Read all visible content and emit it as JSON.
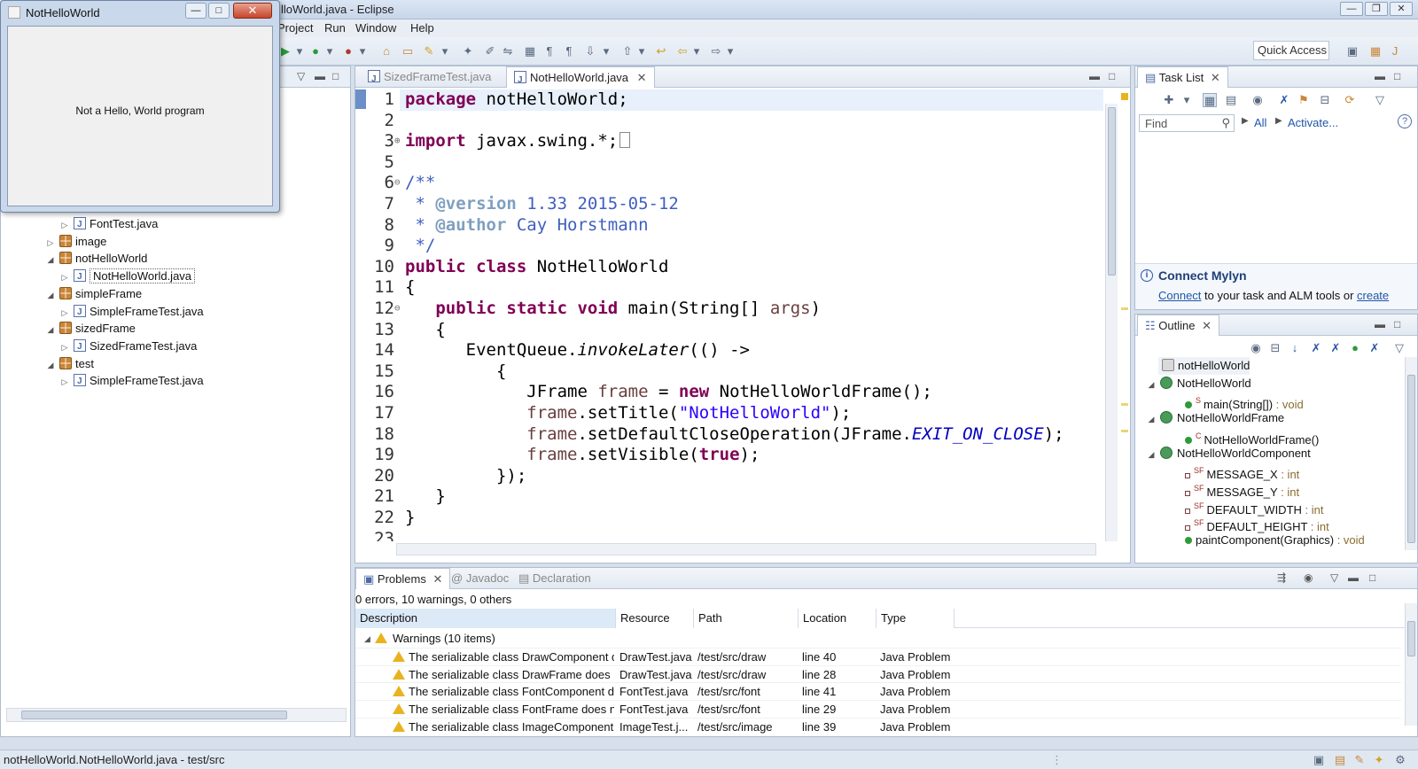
{
  "window": {
    "title": "NotHelloWorld.java - Eclipse",
    "title_visible": "lloWorld.java - Eclipse"
  },
  "menu": {
    "items": [
      "Project",
      "Run",
      "Window",
      "Help"
    ]
  },
  "toolbar": {
    "quick_access": "Quick Access"
  },
  "swing_window": {
    "title": "NotHelloWorld",
    "message": "Not a Hello, World program",
    "close": "✕",
    "min": "—",
    "max": "□"
  },
  "explorer": {
    "items": [
      {
        "label": "FontTest.java",
        "type": "file",
        "depth": 2
      },
      {
        "label": "image",
        "type": "package",
        "depth": 1,
        "expanded": false
      },
      {
        "label": "notHelloWorld",
        "type": "package",
        "depth": 1,
        "expanded": true
      },
      {
        "label": "NotHelloWorld.java",
        "type": "file",
        "depth": 2,
        "selected": true
      },
      {
        "label": "simpleFrame",
        "type": "package",
        "depth": 1,
        "expanded": true
      },
      {
        "label": "SimpleFrameTest.java",
        "type": "file",
        "depth": 2
      },
      {
        "label": "sizedFrame",
        "type": "package",
        "depth": 1,
        "expanded": true
      },
      {
        "label": "SizedFrameTest.java",
        "type": "file",
        "depth": 2
      },
      {
        "label": "test",
        "type": "package",
        "depth": 1,
        "expanded": true
      },
      {
        "label": "SimpleFrameTest.java",
        "type": "file",
        "depth": 2
      }
    ]
  },
  "editor": {
    "tabs": [
      {
        "label": "SizedFrameTest.java",
        "active": false
      },
      {
        "label": "NotHelloWorld.java",
        "active": true
      }
    ],
    "line_numbers": [
      "1",
      "2",
      "3",
      "5",
      "6",
      "7",
      "8",
      "9",
      "10",
      "11",
      "12",
      "13",
      "14",
      "15",
      "16",
      "17",
      "18",
      "19",
      "20",
      "21",
      "22",
      "23"
    ],
    "code": {
      "l1_kw": "package",
      "l1_rest": " notHelloWorld;",
      "l3_kw": "import",
      "l3_rest": " javax.swing.*;",
      "l6": "/**",
      "l7_pre": " * ",
      "l7_tag": "@version",
      "l7_rest": " 1.33 2015-05-12",
      "l8_pre": " * ",
      "l8_tag": "@author",
      "l8_rest": " Cay Horstmann",
      "l9": " */",
      "l10_kw": "public class",
      "l10_rest": " NotHelloWorld",
      "l11": "{",
      "l12_kw": "   public static void",
      "l12_mid": " main(String[] ",
      "l12_var": "args",
      "l12_end": ")",
      "l13": "   {",
      "l14_pre": "      EventQueue.",
      "l14_it": "invokeLater",
      "l14_end": "(() ->",
      "l15": "         {",
      "l16_pre": "            JFrame ",
      "l16_var": "frame",
      "l16_mid": " = ",
      "l16_kw": "new",
      "l16_end": " NotHelloWorldFrame();",
      "l17_var": "            frame",
      "l17_mid": ".setTitle(",
      "l17_str": "\"NotHelloWorld\"",
      "l17_end": ");",
      "l18_var": "            frame",
      "l18_mid": ".setDefaultCloseOperation(JFrame.",
      "l18_cst": "EXIT_ON_CLOSE",
      "l18_end": ");",
      "l19_var": "            frame",
      "l19_mid": ".setVisible(",
      "l19_kw": "true",
      "l19_end": ");",
      "l20": "         });",
      "l21": "   }",
      "l22": "}"
    }
  },
  "tasklist": {
    "tab": "Task List",
    "find_placeholder": "Find",
    "all": "All",
    "activate": "Activate...",
    "help": "?"
  },
  "mylyn": {
    "title": "Connect Mylyn",
    "link": "Connect",
    "text": " to your task and ALM tools or ",
    "link2": "create"
  },
  "outline": {
    "tab": "Outline",
    "items": [
      {
        "label": "notHelloWorld",
        "kind": "package"
      },
      {
        "label": "NotHelloWorld",
        "kind": "class"
      },
      {
        "label": "main(String[])",
        "type": " : void",
        "kind": "method",
        "mod": "S"
      },
      {
        "label": "NotHelloWorldFrame",
        "kind": "class"
      },
      {
        "label": "NotHelloWorldFrame()",
        "type": "",
        "kind": "method",
        "mod": "C"
      },
      {
        "label": "NotHelloWorldComponent",
        "kind": "class"
      },
      {
        "label": "MESSAGE_X",
        "type": " : int",
        "kind": "field",
        "mod": "SF"
      },
      {
        "label": "MESSAGE_Y",
        "type": " : int",
        "kind": "field",
        "mod": "SF"
      },
      {
        "label": "DEFAULT_WIDTH",
        "type": " : int",
        "kind": "field",
        "mod": "SF"
      },
      {
        "label": "DEFAULT_HEIGHT",
        "type": " : int",
        "kind": "field",
        "mod": "SF"
      },
      {
        "label": "paintComponent(Graphics)",
        "type": " : void",
        "kind": "method",
        "mod": ""
      }
    ]
  },
  "problems": {
    "tabs": [
      "Problems",
      "Javadoc",
      "Declaration"
    ],
    "summary": "0 errors, 10 warnings, 0 others",
    "columns": [
      "Description",
      "Resource",
      "Path",
      "Location",
      "Type"
    ],
    "group": "Warnings (10 items)",
    "rows": [
      {
        "desc": "The serializable class DrawComponent d",
        "res": "DrawTest.java",
        "path": "/test/src/draw",
        "loc": "line 40",
        "type": "Java Problem"
      },
      {
        "desc": "The serializable class DrawFrame does n",
        "res": "DrawTest.java",
        "path": "/test/src/draw",
        "loc": "line 28",
        "type": "Java Problem"
      },
      {
        "desc": "The serializable class FontComponent dc",
        "res": "FontTest.java",
        "path": "/test/src/font",
        "loc": "line 41",
        "type": "Java Problem"
      },
      {
        "desc": "The serializable class FontFrame does nc",
        "res": "FontTest.java",
        "path": "/test/src/font",
        "loc": "line 29",
        "type": "Java Problem"
      },
      {
        "desc": "The serializable class ImageComponent c",
        "res": "ImageTest.j...",
        "path": "/test/src/image",
        "loc": "line 39",
        "type": "Java Problem"
      }
    ]
  },
  "status": {
    "text": "notHelloWorld.NotHelloWorld.java - test/src"
  }
}
